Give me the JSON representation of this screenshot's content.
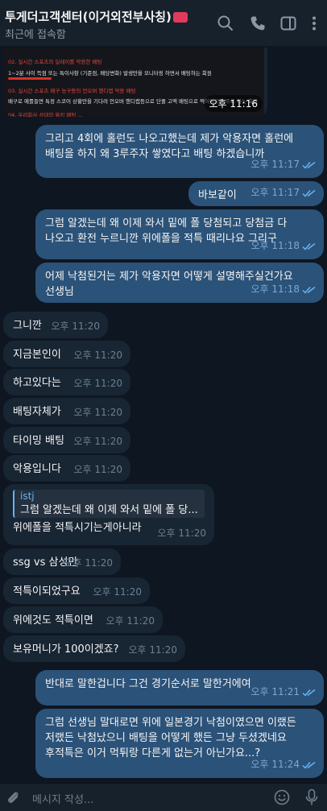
{
  "header": {
    "title": "투게더고객센터(이거외전부사칭)",
    "subtitle": "최근에 접속함",
    "icons": [
      "search-icon",
      "phone-icon",
      "sidebar-icon",
      "more-icon"
    ]
  },
  "media": {
    "lines": [
      "02. 실시간 스포츠의 딜레이를 악용한 배팅",
      "1~2분 사이 득점 또는 특이사항 (기준점, 배당변화) 발생만을 모니터링 하면서 배팅하는 회원",
      "03. 실시간 스포츠 배구 농구등의 언오버 핸디캡 악용 배팅",
      "배구로 예를들면 특정 스코어 상황만을 기다려 언오버 핸디캡등으로 단폴 고액 배팅으로 찍어먹기를 주로 하는 회원",
      "04. 우리회사 상대의 올킹 배팅 ..."
    ],
    "time": "오후 11:16"
  },
  "messages": [
    {
      "dir": "out",
      "text": "그리고 4회에 홀런도 나오고했는데 제가 악용자면 홀런에\n배팅을 하지 왜 3루주자 쌓였다고 배팅 하겠습니까",
      "time": "오후 11:17",
      "read": true
    },
    {
      "dir": "out",
      "text": "바보같이",
      "time": "오후 11:17",
      "read": true
    },
    {
      "dir": "out",
      "text": "그럼 알겠는데 왜 이제 와서 밑에 폴 당첨되고 당첨금 다\n나오고 환전 누르니깐 위에폴을 적특 때리나요 그리구",
      "time": "오후 11:18",
      "read": true
    },
    {
      "dir": "out",
      "text": "어제 낙첨된거는 제가 악용자면 어떻게 설명해주실건가요\n선생님",
      "time": "오후 11:18",
      "read": true
    },
    {
      "dir": "in",
      "text": "그니깐",
      "time": "오후 11:20"
    },
    {
      "dir": "in",
      "text": "지금본인이",
      "time": "오후 11:20"
    },
    {
      "dir": "in",
      "text": "하고있다는",
      "time": "오후 11:20"
    },
    {
      "dir": "in",
      "text": "배팅자체가",
      "time": "오후 11:20"
    },
    {
      "dir": "in",
      "text": "타이밍 배팅",
      "time": "오후 11:20"
    },
    {
      "dir": "in",
      "text": "악용입니다",
      "time": "오후 11:20"
    },
    {
      "dir": "in",
      "reply_name": "istj",
      "reply_text": "그럼 알겠는데 왜 이제 와서 밑에 폴 당...",
      "text": "위에폴을 적특시기는게아니라",
      "time": "오후 11:20"
    },
    {
      "dir": "in",
      "text": "ssg vs 삼성만",
      "time": "오후 11:20"
    },
    {
      "dir": "in",
      "text": "적특이되었구요",
      "time": "오후 11:20"
    },
    {
      "dir": "in",
      "text": "위에것도 적특이면",
      "time": "오후 11:20"
    },
    {
      "dir": "in",
      "text": "보유머니가 100이겠죠?",
      "time": "오후 11:20"
    },
    {
      "dir": "out",
      "text": "반대로 말한겁니다 그건 경기순서로 말한거에여",
      "time": "오후 11:21",
      "read": true
    },
    {
      "dir": "out",
      "text": "그럼 선생님 말대로면 위에 일본경기 낙첨이였으면 이랬든\n저랬든 낙첨났으니 배팅을 어떻게 했든 그냥 두셨겠네요\n후적특은 이거 먹튀랑 다른게 없는거 아닌가요...?",
      "time": "오후 11:24",
      "read": true
    }
  ],
  "composer": {
    "placeholder": "메시지 작성...",
    "icons": [
      "paperclip-icon",
      "emoji-icon",
      "microphone-icon"
    ]
  },
  "colors": {
    "background": "#0e1621",
    "header": "#17212b",
    "outgoing_bubble": "#2b5278",
    "incoming_bubble": "#182533",
    "accent": "#6ab3f3"
  }
}
